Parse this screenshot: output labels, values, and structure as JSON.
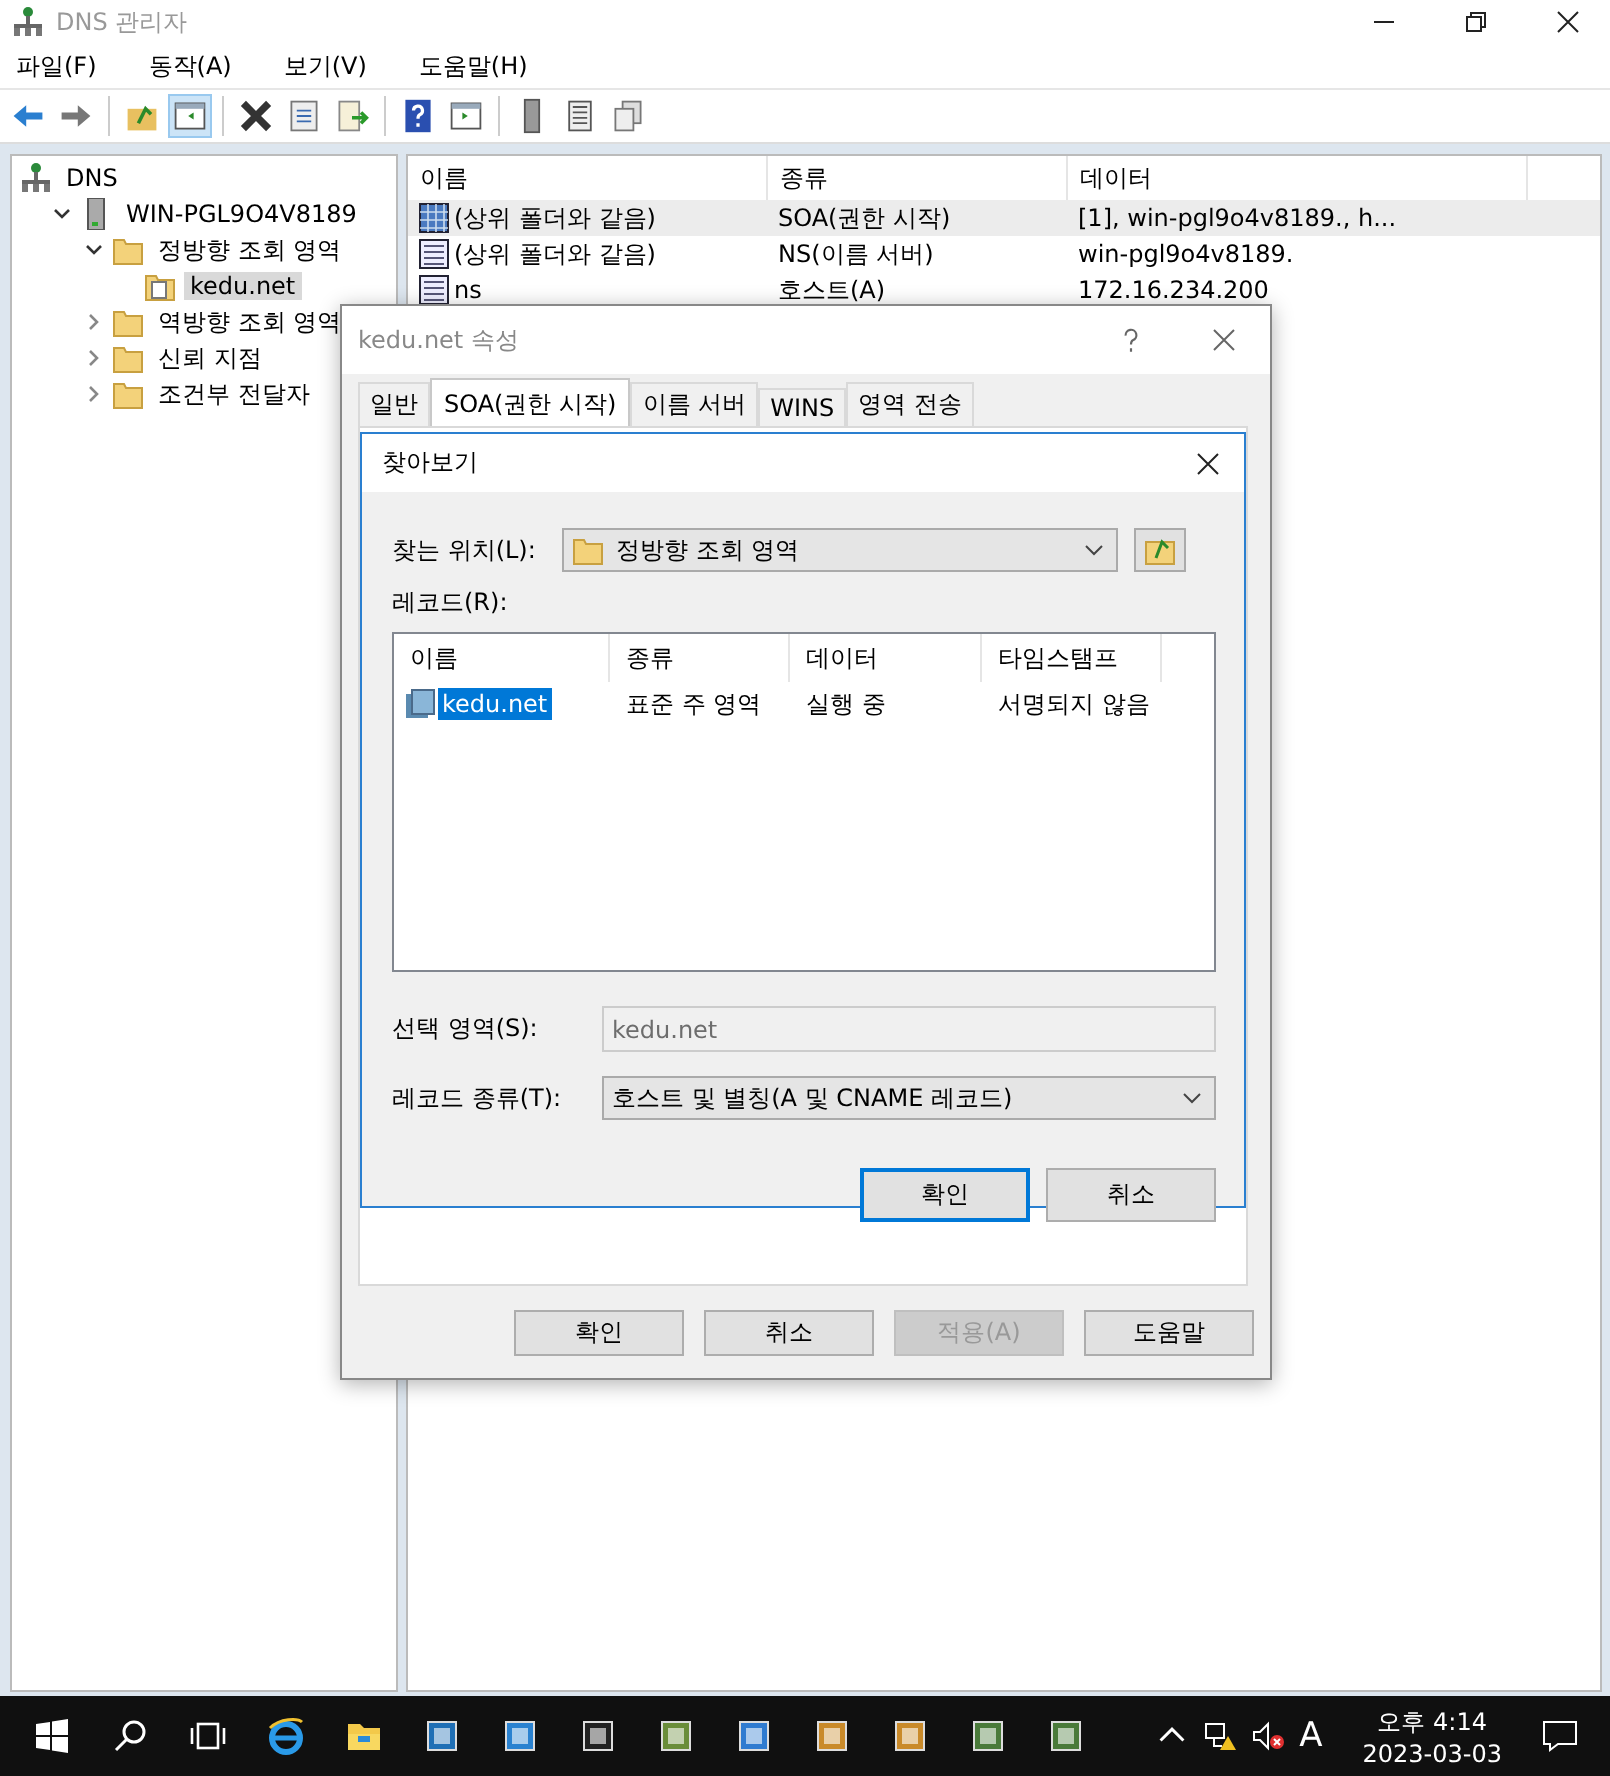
{
  "window": {
    "title": "DNS 관리자"
  },
  "menu": [
    "파일(F)",
    "동작(A)",
    "보기(V)",
    "도움말(H)"
  ],
  "tree": [
    {
      "label": "DNS",
      "kind": "dns",
      "children": [
        {
          "label": "WIN-PGL9O4V8189",
          "kind": "server",
          "expanded": true,
          "selected": false,
          "children": [
            {
              "label": "정방향 조회 영역",
              "kind": "folder",
              "expanded": true,
              "selected": false,
              "children": [
                {
                  "label": "kedu.net",
                  "kind": "zone",
                  "selected": true
                }
              ]
            },
            {
              "label": "역방향 조회 영역",
              "kind": "folder",
              "expanded": false,
              "selected": false
            },
            {
              "label": "신뢰 지점",
              "kind": "folder",
              "expanded": false,
              "selected": false
            },
            {
              "label": "조건부 전달자",
              "kind": "folder",
              "expanded": false,
              "selected": false
            }
          ]
        }
      ],
      "selected": false
    }
  ],
  "list": {
    "columns": [
      "이름",
      "종류",
      "데이터"
    ],
    "rows": [
      {
        "kind": "soa",
        "selected": true,
        "cells": [
          "(상위 폴더와 같음)",
          "SOA(권한 시작)",
          "[1], win-pgl9o4v8189., h..."
        ]
      },
      {
        "kind": "record",
        "selected": false,
        "cells": [
          "(상위 폴더와 같음)",
          "NS(이름 서버)",
          "win-pgl9o4v8189."
        ]
      },
      {
        "kind": "record",
        "selected": false,
        "cells": [
          "ns",
          "호스트(A)",
          "172.16.234.200"
        ]
      }
    ]
  },
  "properties_dialog": {
    "title": "kedu.net 속성",
    "tabs": [
      {
        "label": "일반",
        "selected": false
      },
      {
        "label": "SOA(권한 시작)",
        "selected": true
      },
      {
        "label": "이름 서버",
        "selected": false
      },
      {
        "label": "WINS",
        "selected": false
      },
      {
        "label": "영역 전송",
        "selected": false
      }
    ],
    "buttons": [
      {
        "label": "확인",
        "disabled": false
      },
      {
        "label": "취소",
        "disabled": false
      },
      {
        "label": "적용(A)",
        "disabled": true
      },
      {
        "label": "도움말",
        "disabled": false
      }
    ]
  },
  "browse_dialog": {
    "title": "찾아보기",
    "look_in_label": "찾는 위치(L):",
    "look_in_value": "정방향 조회 영역",
    "records_label": "레코드(R):",
    "columns": [
      "이름",
      "종류",
      "데이터",
      "타임스탬프"
    ],
    "rows": [
      {
        "selected": true,
        "cells": [
          "kedu.net",
          "표준 주 영역",
          "실행 중",
          "서명되지 않음"
        ]
      }
    ],
    "selected_zone_label": "선택 영역(S):",
    "selected_zone_value": "kedu.net",
    "record_type_label": "레코드 종류(T):",
    "record_type_value": "호스트 및 별칭(A 및 CNAME 레코드)",
    "buttons": [
      {
        "label": "확인",
        "default": true
      },
      {
        "label": "취소",
        "default": false
      }
    ]
  },
  "taskbar": {
    "ime": "A",
    "time": "오후 4:14",
    "date": "2023-03-03"
  }
}
